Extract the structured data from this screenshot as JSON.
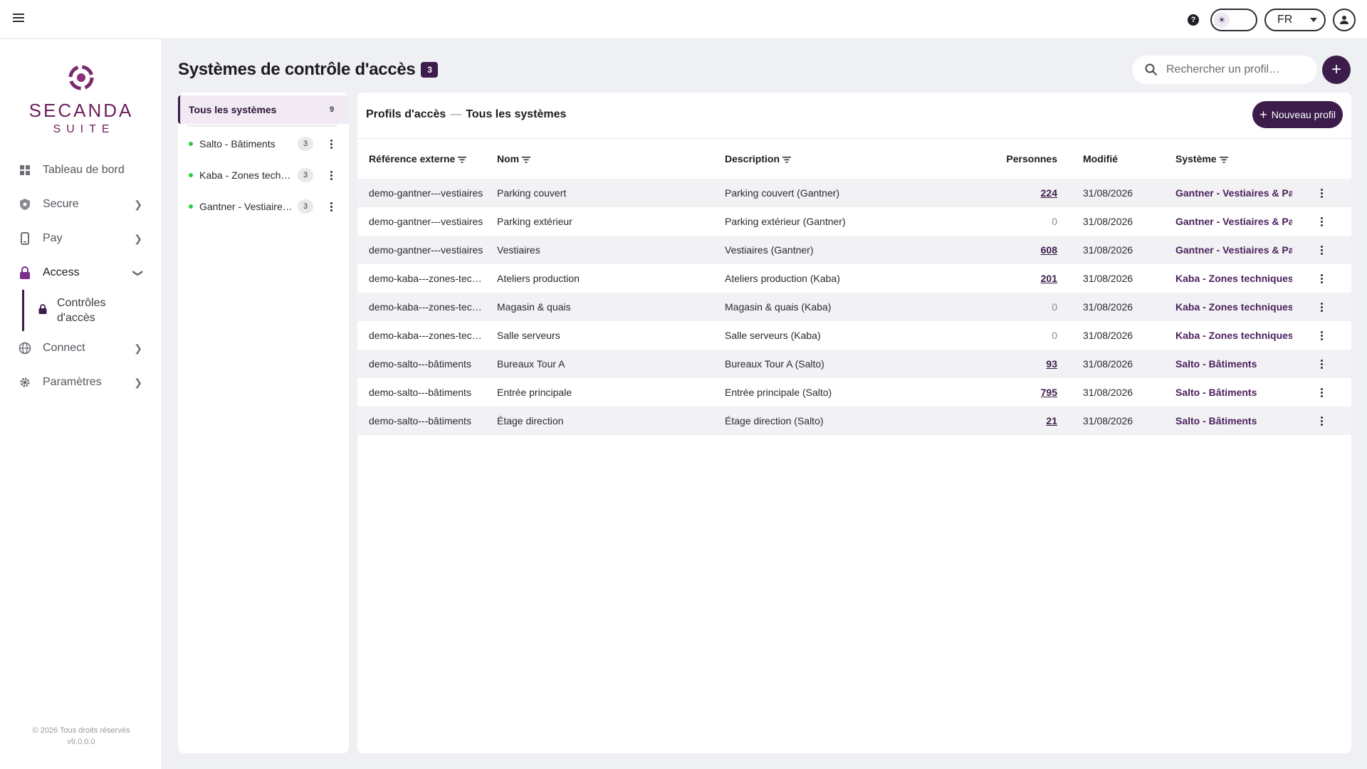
{
  "topbar": {
    "language": "FR",
    "icons": [
      "menu-icon",
      "help-icon",
      "sun-icon",
      "user-icon"
    ]
  },
  "brand": {
    "name": "SECANDA",
    "suite": "SUITE",
    "color": "#6e1f5c"
  },
  "sidebar": {
    "items": [
      {
        "label": "Tableau de bord",
        "icon": "grid-icon"
      },
      {
        "label": "Secure",
        "icon": "shield-icon"
      },
      {
        "label": "Pay",
        "icon": "phone-icon"
      },
      {
        "label": "Access",
        "icon": "lock-icon"
      },
      {
        "label": "Connect",
        "icon": "globe-icon"
      },
      {
        "label": "Paramètres",
        "icon": "gear-icon"
      }
    ],
    "sub_item": {
      "label": "Contrôles d'accès",
      "icon": "lock-icon"
    },
    "footer_copyright": "© 2026 Tous droits réservés",
    "footer_version": "v9.0.0.0"
  },
  "page": {
    "title": "Systèmes de contrôle d'accès",
    "count": "3",
    "search_placeholder": "Rechercher un profil…",
    "accent": "#3b1c4b"
  },
  "systems": {
    "all": {
      "label": "Tous les systèmes",
      "count": "9"
    },
    "items": [
      {
        "label": "Salto - Bâtiments",
        "count": "3"
      },
      {
        "label": "Kaba - Zones techniques",
        "count": "3"
      },
      {
        "label": "Gantner - Vestiaires & Parking",
        "count": "3"
      }
    ]
  },
  "profiles": {
    "title": "Profils d'accès",
    "subtitle": "Tous les systèmes",
    "new_button": "Nouveau profil",
    "columns": {
      "ref": "Référence externe",
      "name": "Nom",
      "desc": "Description",
      "persons": "Personnes",
      "modified": "Modifié",
      "system": "Système"
    },
    "rows": [
      {
        "ref": "demo-gantner---vestiaires",
        "name": "Parking couvert",
        "desc": "Parking couvert (Gantner)",
        "persons": "224",
        "modified": "31/08/2026",
        "system": "Gantner - Vestiaires & Pa"
      },
      {
        "ref": "demo-gantner---vestiaires",
        "name": "Parking extérieur",
        "desc": "Parking extérieur (Gantner)",
        "persons": "0",
        "modified": "31/08/2026",
        "system": "Gantner - Vestiaires & Pa"
      },
      {
        "ref": "demo-gantner---vestiaires",
        "name": "Vestiaires",
        "desc": "Vestiaires (Gantner)",
        "persons": "608",
        "modified": "31/08/2026",
        "system": "Gantner - Vestiaires & Pa"
      },
      {
        "ref": "demo-kaba---zones-techniques",
        "name": "Ateliers production",
        "desc": "Ateliers production (Kaba)",
        "persons": "201",
        "modified": "31/08/2026",
        "system": "Kaba - Zones techniques"
      },
      {
        "ref": "demo-kaba---zones-techniques",
        "name": "Magasin & quais",
        "desc": "Magasin & quais (Kaba)",
        "persons": "0",
        "modified": "31/08/2026",
        "system": "Kaba - Zones techniques"
      },
      {
        "ref": "demo-kaba---zones-techniques",
        "name": "Salle serveurs",
        "desc": "Salle serveurs (Kaba)",
        "persons": "0",
        "modified": "31/08/2026",
        "system": "Kaba - Zones techniques"
      },
      {
        "ref": "demo-salto---bâtiments",
        "name": "Bureaux Tour A",
        "desc": "Bureaux Tour A (Salto)",
        "persons": "93",
        "modified": "31/08/2026",
        "system": "Salto - Bâtiments"
      },
      {
        "ref": "demo-salto---bâtiments",
        "name": "Entrée principale",
        "desc": "Entrée principale (Salto)",
        "persons": "795",
        "modified": "31/08/2026",
        "system": "Salto - Bâtiments"
      },
      {
        "ref": "demo-salto---bâtiments",
        "name": "Étage direction",
        "desc": "Étage direction (Salto)",
        "persons": "21",
        "modified": "31/08/2026",
        "system": "Salto - Bâtiments"
      }
    ]
  }
}
